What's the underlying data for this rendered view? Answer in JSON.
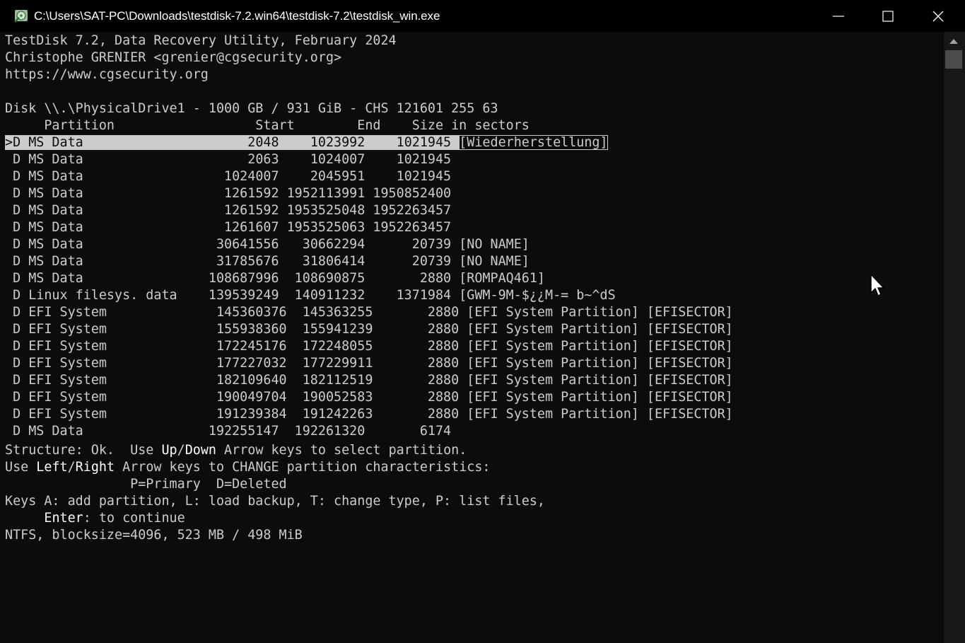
{
  "window": {
    "title": "C:\\Users\\SAT-PC\\Downloads\\testdisk-7.2.win64\\testdisk-7.2\\testdisk_win.exe",
    "buttons": [
      "minimize-icon",
      "maximize-icon",
      "close-icon"
    ]
  },
  "header": {
    "line1": "TestDisk 7.2, Data Recovery Utility, February 2024",
    "line2": "Christophe GRENIER <grenier@cgsecurity.org>",
    "line3": "https://www.cgsecurity.org"
  },
  "disk": {
    "info": "Disk \\\\.\\PhysicalDrive1 - 1000 GB / 931 GiB - CHS 121601 255 63",
    "columns_header": "     Partition                  Start        End    Size in sectors"
  },
  "partitions": [
    {
      "prefix": ">D MS Data",
      "numbers": "                     2048    1023992    1021945 ",
      "label": "[Wiederherstellung]"
    },
    {
      "prefix": " D MS Data",
      "numbers": "                     2063    1024007    1021945",
      "label": ""
    },
    {
      "prefix": " D MS Data",
      "numbers": "                  1024007    2045951    1021945",
      "label": ""
    },
    {
      "prefix": " D MS Data",
      "numbers": "                  1261592 1952113991 1950852400",
      "label": ""
    },
    {
      "prefix": " D MS Data",
      "numbers": "                  1261592 1953525048 1952263457",
      "label": ""
    },
    {
      "prefix": " D MS Data",
      "numbers": "                  1261607 1953525063 1952263457",
      "label": ""
    },
    {
      "prefix": " D MS Data",
      "numbers": "                 30641556   30662294      20739 ",
      "label": "[NO NAME]"
    },
    {
      "prefix": " D MS Data",
      "numbers": "                 31785676   31806414      20739 ",
      "label": "[NO NAME]"
    },
    {
      "prefix": " D MS Data",
      "numbers": "                108687996  108690875       2880 ",
      "label": "[ROMPAQ461]"
    },
    {
      "prefix": " D Linux filesys. data",
      "numbers": "    139539249  140911232    1371984 ",
      "label": "[GWM-9M-$¿¿M-= b~^dS"
    },
    {
      "prefix": " D EFI System",
      "numbers": "              145360376  145363255       2880 ",
      "label": "[EFI System Partition] [EFISECTOR]"
    },
    {
      "prefix": " D EFI System",
      "numbers": "              155938360  155941239       2880 ",
      "label": "[EFI System Partition] [EFISECTOR]"
    },
    {
      "prefix": " D EFI System",
      "numbers": "              172245176  172248055       2880 ",
      "label": "[EFI System Partition] [EFISECTOR]"
    },
    {
      "prefix": " D EFI System",
      "numbers": "              177227032  177229911       2880 ",
      "label": "[EFI System Partition] [EFISECTOR]"
    },
    {
      "prefix": " D EFI System",
      "numbers": "              182109640  182112519       2880 ",
      "label": "[EFI System Partition] [EFISECTOR]"
    },
    {
      "prefix": " D EFI System",
      "numbers": "              190049704  190052583       2880 ",
      "label": "[EFI System Partition] [EFISECTOR]"
    },
    {
      "prefix": " D EFI System",
      "numbers": "              191239384  191242263       2880 ",
      "label": "[EFI System Partition] [EFISECTOR]"
    },
    {
      "prefix": " D MS Data",
      "numbers": "                192255147  192261320       6174",
      "label": ""
    }
  ],
  "footer": {
    "structure_a": "Structure: Ok.  Use ",
    "structure_b": "Up",
    "structure_c": "/",
    "structure_d": "Down",
    "structure_e": " Arrow keys to select partition.",
    "change_a": "Use ",
    "change_b": "Left",
    "change_c": "/",
    "change_d": "Right",
    "change_e": " Arrow keys to CHANGE partition characteristics:",
    "legend": "                P=Primary  D=Deleted",
    "keys": "Keys A: add partition, L: load backup, T: change type, P: list files,",
    "enter_indent": "     ",
    "enter_key": "Enter",
    "enter_rest": ": to continue",
    "fs_info": "NTFS, blocksize=4096, 523 MB / 498 MiB"
  },
  "colors": {
    "background": "#0c0c0c",
    "text": "#cccccc",
    "highlight": "#ffffff",
    "selection_bg": "#cccccc"
  }
}
